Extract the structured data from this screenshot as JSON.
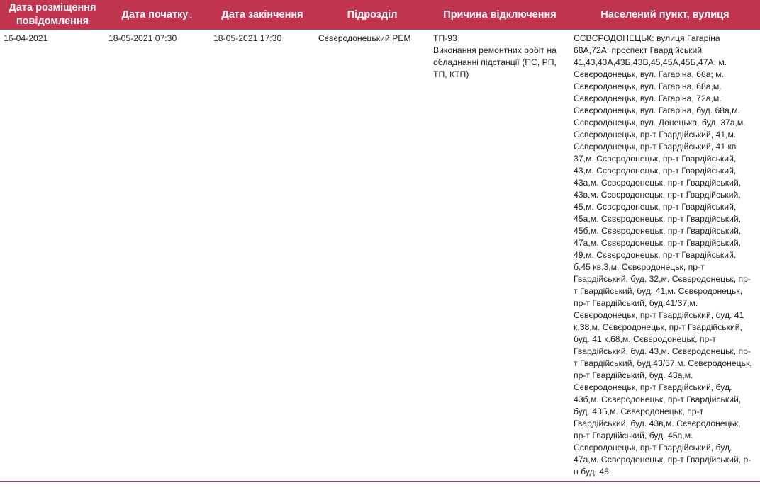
{
  "table": {
    "headers": {
      "message_date": "Дата розміщення повідомлення",
      "start_date": "Дата початку",
      "end_date": "Дата закінчення",
      "unit": "Підрозділ",
      "reason": "Причина відключення",
      "location": "Населений пункт, вулиця"
    },
    "sort_indicator": "↓",
    "rows": [
      {
        "message_date": "16-04-2021",
        "start_date": "18-05-2021 07:30",
        "end_date": "18-05-2021 17:30",
        "unit": "Сєвєродонецький РЕМ",
        "reason_code": "ТП-93",
        "reason_text": "Виконання ремонтних робіт на обладнанні підстанції (ПС, РП, ТП, КТП)",
        "location": "СЄВЄРОДОНЕЦЬК: вулиця Гагаріна 68А,72А; проспект Гвардійський 41,43,43А,43Б,43В,45,45А,45Б,47А; м. Сєвєродонецьк, вул. Гагаріна, 68а; м. Сєвєродонецьк, вул. Гагаріна, 68а,м. Сєвєродонецьк, вул. Гагаріна, 72а,м. Сєвєродонецьк, вул. Гагаріна, буд. 68а,м. Сєвєродонецьк, вул. Донецька, буд. 37а,м. Сєвєродонецьк, пр-т Гвардійський, 41,м. Сєвєродонецьк, пр-т Гвардійський, 41 кв 37,м. Сєвєродонецьк, пр-т Гвардійський, 43,м. Сєвєродонецьк, пр-т Гвардійський, 43а,м. Сєвєродонецьк, пр-т Гвардійський, 43в,м. Сєвєродонецьк, пр-т Гвардійський, 45,м. Сєвєродонецьк, пр-т Гвардійський, 45а,м. Сєвєродонецьк, пр-т Гвардійський, 45б,м. Сєвєродонецьк, пр-т Гвардійський, 47а,м. Сєвєродонецьк, пр-т Гвардійський, 49,м. Сєвєродонецьк, пр-т Гвардійський, б.45 кв.3,м. Сєвєродонецьк, пр-т Гвардійський, буд. 32,м. Сєвєродонецьк, пр-т Гвардійський, буд. 41,м. Сєвєродонецьк, пр-т Гвардійський, буд.41/37,м. Сєвєродонецьк, пр-т Гвардійський, буд. 41 к.38,м. Сєвєродонецьк, пр-т Гвардійський, буд. 41 к.68,м. Сєвєродонецьк, пр-т Гвардійський, буд. 43,м. Сєвєродонецьк, пр-т Гвардійський, буд.43/57,м. Сєвєродонецьк, пр-т Гвардійський, буд. 43а,м. Сєвєродонецьк, пр-т Гвардійський, буд. 43б,м. Сєвєродонецьк, пр-т Гвардійський, буд. 43Б,м. Сєвєродонецьк, пр-т Гвардійський, буд. 43в,м. Сєвєродонецьк, пр-т Гвардійський, буд. 45а,м. Сєвєродонецьк, пр-т Гвардійський, буд. 47а,м. Сєвєродонецьк, пр-т Гвардійський, р-н буд. 45"
      }
    ]
  },
  "colors": {
    "header_bg": "#c0344f",
    "header_text": "#ffffff",
    "body_text": "#222222"
  }
}
